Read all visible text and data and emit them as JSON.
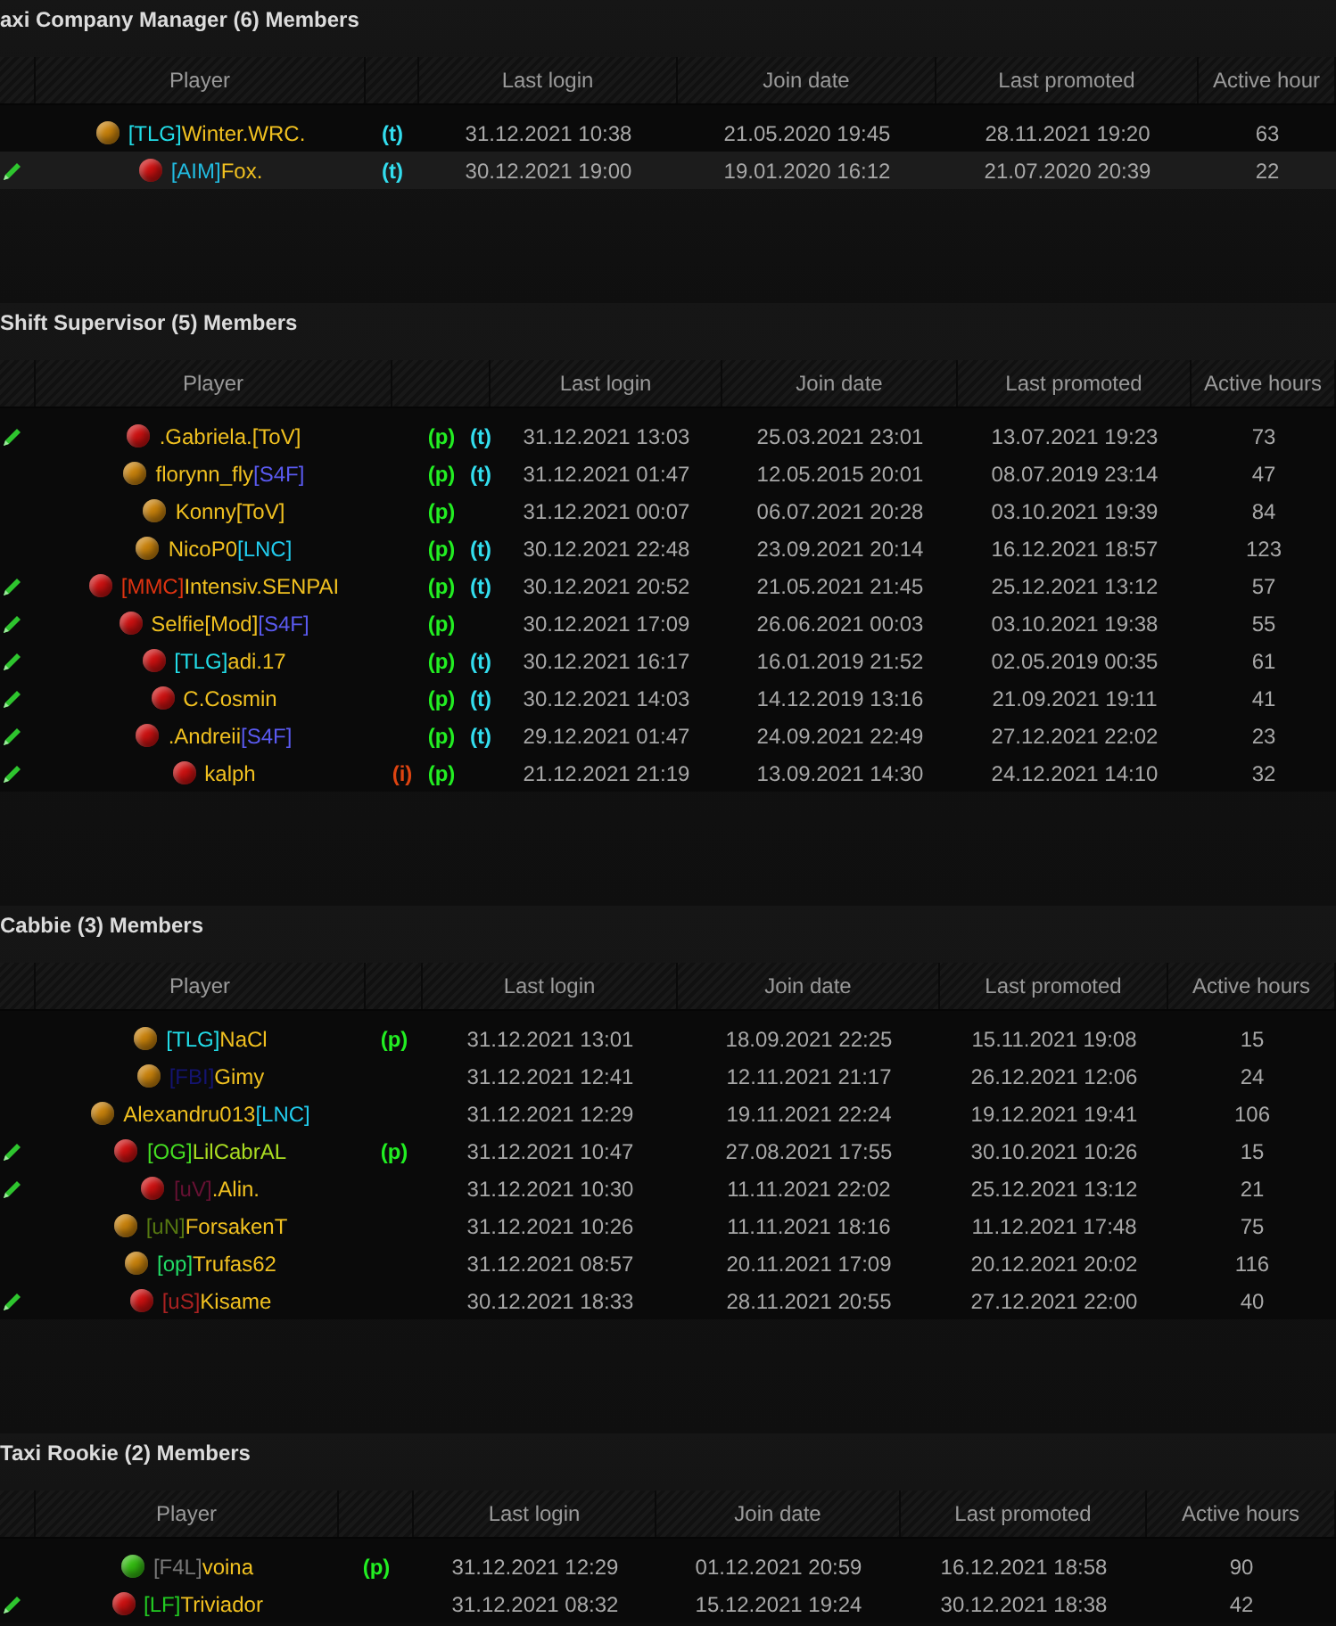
{
  "groups": [
    {
      "title": "axi Company Manager (6) Members",
      "columns": [
        "Player",
        "Last login",
        "Join date",
        "Last promoted",
        "Active hour"
      ],
      "rows": [
        {
          "editable": false,
          "highlighted": false,
          "color": "#c8820c",
          "player": [
            {
              "text": "[TLG]",
              "color": "#22dde8"
            },
            {
              "text": "Winter.WRC.",
              "color": "#f0c020"
            }
          ],
          "flags": [
            {
              "kind": "t",
              "text": "(t)"
            }
          ],
          "last_login": "31.12.2021 10:38",
          "join_date": "21.05.2020 19:45",
          "last_promoted": "28.11.2021 19:20",
          "active_hours": "63"
        },
        {
          "editable": true,
          "highlighted": true,
          "color": "#cc1111",
          "player": [
            {
              "text": "[AIM]",
              "color": "#22bbe0"
            },
            {
              "text": "Fox.",
              "color": "#f0c020"
            }
          ],
          "flags": [
            {
              "kind": "t",
              "text": "(t)"
            }
          ],
          "last_login": "30.12.2021 19:00",
          "join_date": "19.01.2020 16:12",
          "last_promoted": "21.07.2020 20:39",
          "active_hours": "22"
        }
      ]
    },
    {
      "title": "Shift Supervisor (5) Members",
      "columns": [
        "Player",
        "Last login",
        "Join date",
        "Last promoted",
        "Active hours"
      ],
      "rows": [
        {
          "editable": true,
          "highlighted": false,
          "color": "#cc1111",
          "player": [
            {
              "text": ".Gabriela.[ToV]",
              "color": "#f0c020"
            }
          ],
          "flags": [
            {
              "kind": "p",
              "text": "(p)"
            },
            {
              "kind": "t",
              "text": "(t)"
            }
          ],
          "last_login": "31.12.2021 13:03",
          "join_date": "25.03.2021 23:01",
          "last_promoted": "13.07.2021 19:23",
          "active_hours": "73"
        },
        {
          "editable": false,
          "highlighted": false,
          "color": "#c8820c",
          "player": [
            {
              "text": "florynn_fly",
              "color": "#f0c020"
            },
            {
              "text": "[S4F]",
              "color": "#5a5af0"
            }
          ],
          "flags": [
            {
              "kind": "p",
              "text": "(p)"
            },
            {
              "kind": "t",
              "text": "(t)"
            }
          ],
          "last_login": "31.12.2021 01:47",
          "join_date": "12.05.2015 20:01",
          "last_promoted": "08.07.2019 23:14",
          "active_hours": "47"
        },
        {
          "editable": false,
          "highlighted": false,
          "color": "#c8820c",
          "player": [
            {
              "text": "Konny[ToV]",
              "color": "#f0c020"
            }
          ],
          "flags": [
            {
              "kind": "p",
              "text": "(p)"
            }
          ],
          "last_login": "31.12.2021 00:07",
          "join_date": "06.07.2021 20:28",
          "last_promoted": "03.10.2021 19:39",
          "active_hours": "84"
        },
        {
          "editable": false,
          "highlighted": false,
          "color": "#c8820c",
          "player": [
            {
              "text": "NicoP0",
              "color": "#f0c020"
            },
            {
              "text": "[LNC]",
              "color": "#22ccee"
            }
          ],
          "flags": [
            {
              "kind": "p",
              "text": "(p)"
            },
            {
              "kind": "t",
              "text": "(t)"
            }
          ],
          "last_login": "30.12.2021 22:48",
          "join_date": "23.09.2021 20:14",
          "last_promoted": "16.12.2021 18:57",
          "active_hours": "123"
        },
        {
          "editable": true,
          "highlighted": false,
          "color": "#cc1111",
          "player": [
            {
              "text": "[MMC]",
              "color": "#dd3311"
            },
            {
              "text": "Intensiv.SENPAI",
              "color": "#f0c020"
            }
          ],
          "flags": [
            {
              "kind": "p",
              "text": "(p)"
            },
            {
              "kind": "t",
              "text": "(t)"
            }
          ],
          "last_login": "30.12.2021 20:52",
          "join_date": "21.05.2021 21:45",
          "last_promoted": "25.12.2021 13:12",
          "active_hours": "57"
        },
        {
          "editable": true,
          "highlighted": false,
          "color": "#cc1111",
          "player": [
            {
              "text": "Selfie[Mod]",
              "color": "#f0c020"
            },
            {
              "text": "[S4F]",
              "color": "#5a5af0"
            }
          ],
          "flags": [
            {
              "kind": "p",
              "text": "(p)"
            }
          ],
          "last_login": "30.12.2021 17:09",
          "join_date": "26.06.2021 00:03",
          "last_promoted": "03.10.2021 19:38",
          "active_hours": "55"
        },
        {
          "editable": true,
          "highlighted": false,
          "color": "#cc1111",
          "player": [
            {
              "text": "[TLG]",
              "color": "#22dde8"
            },
            {
              "text": "adi.17",
              "color": "#f0c020"
            }
          ],
          "flags": [
            {
              "kind": "p",
              "text": "(p)"
            },
            {
              "kind": "t",
              "text": "(t)"
            }
          ],
          "last_login": "30.12.2021 16:17",
          "join_date": "16.01.2019 21:52",
          "last_promoted": "02.05.2019 00:35",
          "active_hours": "61"
        },
        {
          "editable": true,
          "highlighted": false,
          "color": "#cc1111",
          "player": [
            {
              "text": "C.Cosmin",
              "color": "#f0c020"
            }
          ],
          "flags": [
            {
              "kind": "p",
              "text": "(p)"
            },
            {
              "kind": "t",
              "text": "(t)"
            }
          ],
          "last_login": "30.12.2021 14:03",
          "join_date": "14.12.2019 13:16",
          "last_promoted": "21.09.2021 19:11",
          "active_hours": "41"
        },
        {
          "editable": true,
          "highlighted": false,
          "color": "#cc1111",
          "player": [
            {
              "text": ".Andreii",
              "color": "#f0c020"
            },
            {
              "text": "[S4F]",
              "color": "#5a5af0"
            }
          ],
          "flags": [
            {
              "kind": "p",
              "text": "(p)"
            },
            {
              "kind": "t",
              "text": "(t)"
            }
          ],
          "last_login": "29.12.2021 01:47",
          "join_date": "24.09.2021 22:49",
          "last_promoted": "27.12.2021 22:02",
          "active_hours": "23"
        },
        {
          "editable": true,
          "highlighted": false,
          "color": "#cc1111",
          "player": [
            {
              "text": "kalph",
              "color": "#f0c020"
            }
          ],
          "flags": [
            {
              "kind": "i",
              "text": "(i)"
            },
            {
              "kind": "p",
              "text": "(p)"
            }
          ],
          "last_login": "21.12.2021 21:19",
          "join_date": "13.09.2021 14:30",
          "last_promoted": "24.12.2021 14:10",
          "active_hours": "32"
        }
      ]
    },
    {
      "title": "Cabbie (3) Members",
      "columns": [
        "Player",
        "Last login",
        "Join date",
        "Last promoted",
        "Active hours"
      ],
      "rows": [
        {
          "editable": false,
          "highlighted": false,
          "color": "#c8820c",
          "player": [
            {
              "text": "[TLG]",
              "color": "#22dde8"
            },
            {
              "text": "NaCl",
              "color": "#f0c020"
            }
          ],
          "flags": [
            {
              "kind": "p",
              "text": "(p)"
            }
          ],
          "last_login": "31.12.2021 13:01",
          "join_date": "18.09.2021 22:25",
          "last_promoted": "15.11.2021 19:08",
          "active_hours": "15"
        },
        {
          "editable": false,
          "highlighted": false,
          "color": "#c8820c",
          "player": [
            {
              "text": "[FBI]",
              "color": "#141470"
            },
            {
              "text": "Gimy",
              "color": "#f0c020"
            }
          ],
          "flags": [],
          "last_login": "31.12.2021 12:41",
          "join_date": "12.11.2021 21:17",
          "last_promoted": "26.12.2021 12:06",
          "active_hours": "24"
        },
        {
          "editable": false,
          "highlighted": false,
          "color": "#c8820c",
          "player": [
            {
              "text": "Alexandru013",
              "color": "#f0c020"
            },
            {
              "text": "[LNC]",
              "color": "#22ccee"
            }
          ],
          "flags": [],
          "last_login": "31.12.2021 12:29",
          "join_date": "19.11.2021 22:24",
          "last_promoted": "19.12.2021 19:41",
          "active_hours": "106"
        },
        {
          "editable": true,
          "highlighted": false,
          "color": "#cc1111",
          "player": [
            {
              "text": "[OG]",
              "color": "#44dd22"
            },
            {
              "text": "LilCabrAL",
              "color": "#aadd22"
            }
          ],
          "flags": [
            {
              "kind": "p",
              "text": "(p)"
            }
          ],
          "last_login": "31.12.2021 10:47",
          "join_date": "27.08.2021 17:55",
          "last_promoted": "30.10.2021 10:26",
          "active_hours": "15"
        },
        {
          "editable": true,
          "highlighted": false,
          "color": "#cc1111",
          "player": [
            {
              "text": "[uV]",
              "color": "#661133"
            },
            {
              "text": ".Alin.",
              "color": "#f0c020"
            }
          ],
          "flags": [],
          "last_login": "31.12.2021 10:30",
          "join_date": "11.11.2021 22:02",
          "last_promoted": "25.12.2021 13:12",
          "active_hours": "21"
        },
        {
          "editable": false,
          "highlighted": false,
          "color": "#c8820c",
          "player": [
            {
              "text": "[uN]",
              "color": "#557711"
            },
            {
              "text": "ForsakenT",
              "color": "#f0c020"
            }
          ],
          "flags": [],
          "last_login": "31.12.2021 10:26",
          "join_date": "11.11.2021 18:16",
          "last_promoted": "11.12.2021 17:48",
          "active_hours": "75"
        },
        {
          "editable": false,
          "highlighted": false,
          "color": "#c8820c",
          "player": [
            {
              "text": "[op]",
              "color": "#22dd66"
            },
            {
              "text": "Trufas62",
              "color": "#f0c020"
            }
          ],
          "flags": [],
          "last_login": "31.12.2021 08:57",
          "join_date": "20.11.2021 17:09",
          "last_promoted": "20.12.2021 20:02",
          "active_hours": "116"
        },
        {
          "editable": true,
          "highlighted": false,
          "color": "#cc1111",
          "player": [
            {
              "text": "[uS]",
              "color": "#aa2222"
            },
            {
              "text": "Kisame",
              "color": "#f0c020"
            }
          ],
          "flags": [],
          "last_login": "30.12.2021 18:33",
          "join_date": "28.11.2021 20:55",
          "last_promoted": "27.12.2021 22:00",
          "active_hours": "40"
        }
      ]
    },
    {
      "title": "Taxi Rookie (2) Members",
      "columns": [
        "Player",
        "Last login",
        "Join date",
        "Last promoted",
        "Active hours"
      ],
      "rows": [
        {
          "editable": false,
          "highlighted": false,
          "color": "#33bb11",
          "player": [
            {
              "text": "[F4L]",
              "color": "#777777"
            },
            {
              "text": "voina",
              "color": "#f0c020"
            }
          ],
          "flags": [
            {
              "kind": "p",
              "text": "(p)"
            }
          ],
          "last_login": "31.12.2021 12:29",
          "join_date": "01.12.2021 20:59",
          "last_promoted": "16.12.2021 18:58",
          "active_hours": "90"
        },
        {
          "editable": true,
          "highlighted": false,
          "color": "#cc1111",
          "player": [
            {
              "text": "[LF]",
              "color": "#22cc22"
            },
            {
              "text": "Triviador",
              "color": "#f0c020"
            }
          ],
          "flags": [],
          "last_login": "31.12.2021 08:32",
          "join_date": "15.12.2021 19:24",
          "last_promoted": "30.12.2021 18:38",
          "active_hours": "42"
        }
      ]
    }
  ]
}
